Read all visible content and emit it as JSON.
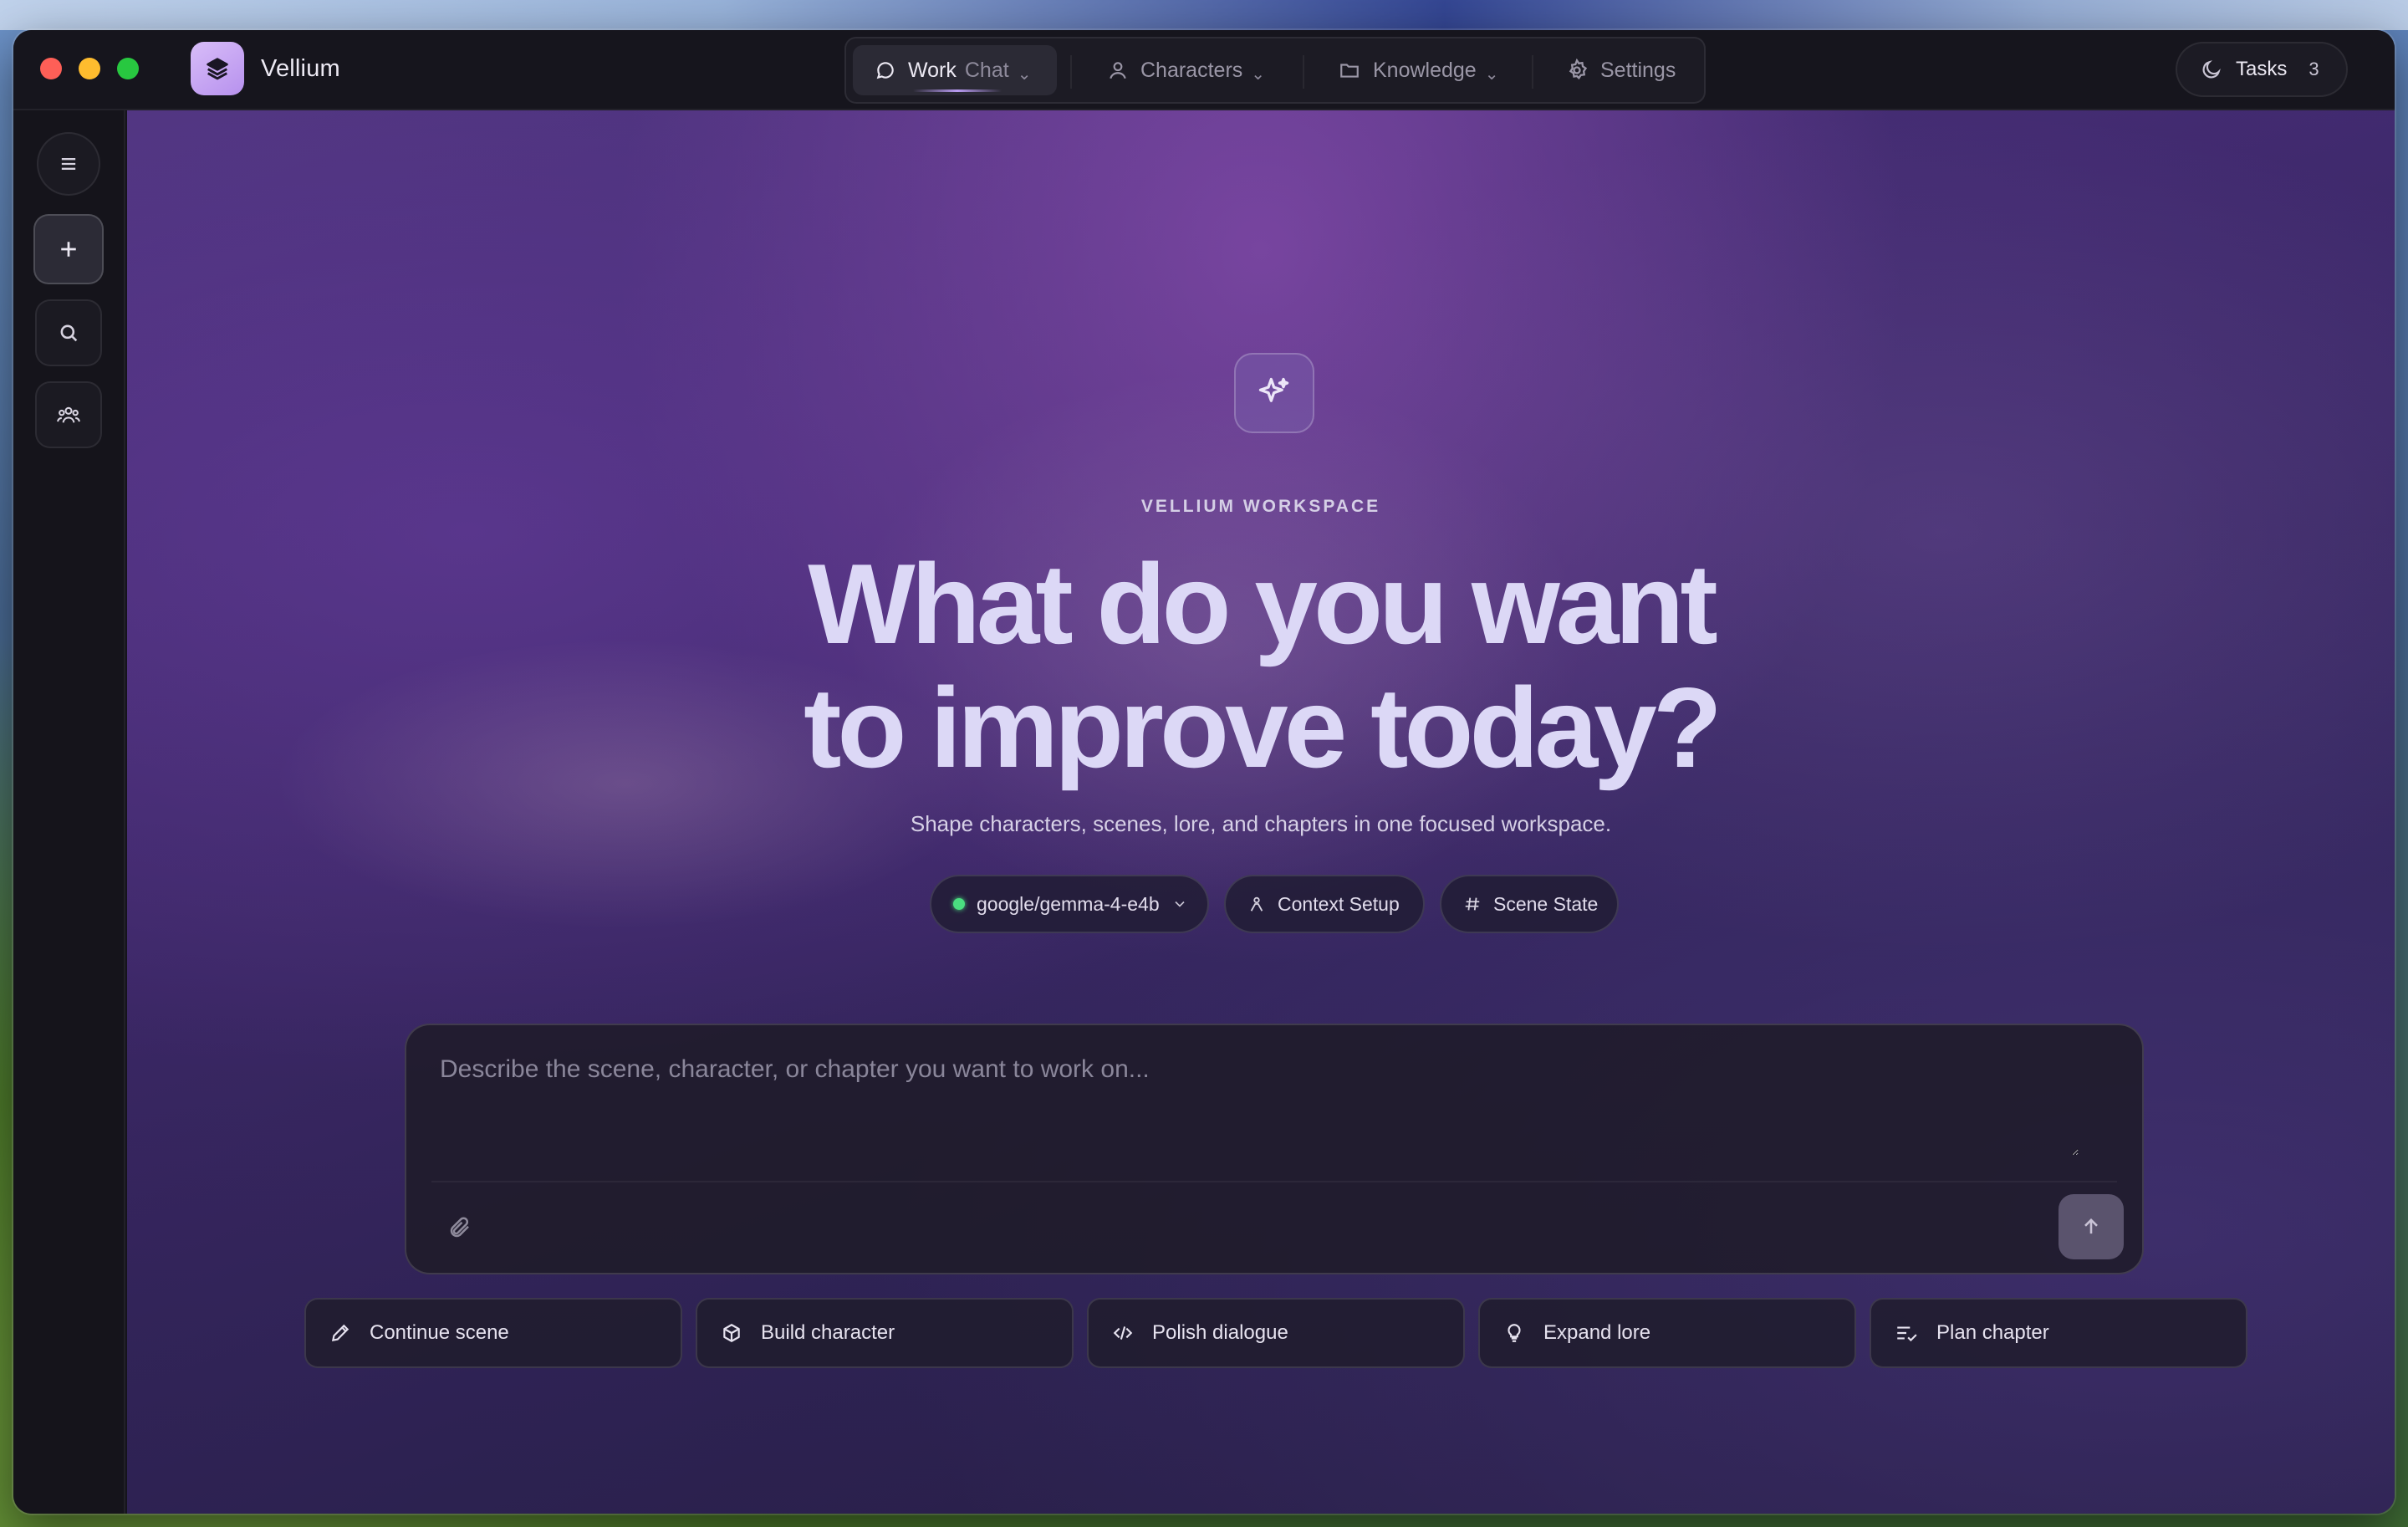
{
  "app": {
    "name": "Vellium"
  },
  "nav": {
    "work_label": "Work",
    "chat_label": "Chat",
    "characters_label": "Characters",
    "knowledge_label": "Knowledge",
    "settings_label": "Settings"
  },
  "tasks": {
    "label": "Tasks",
    "count": "3"
  },
  "hero": {
    "eyebrow": "VELLIUM WORKSPACE",
    "headline_line1": "What do you want",
    "headline_line2": "to improve today?",
    "subline": "Shape characters, scenes, lore, and chapters in one focused workspace."
  },
  "chips": {
    "model": "google/gemma-4-e4b",
    "model_status_color": "#4ade80",
    "context": "Context Setup",
    "scene": "Scene State"
  },
  "composer": {
    "placeholder": "Describe the scene, character, or chapter you want to work on..."
  },
  "quick_actions": [
    {
      "label": "Continue scene",
      "icon": "pencil-icon"
    },
    {
      "label": "Build character",
      "icon": "cube-icon"
    },
    {
      "label": "Polish dialogue",
      "icon": "code-icon"
    },
    {
      "label": "Expand lore",
      "icon": "lightbulb-icon"
    },
    {
      "label": "Plan chapter",
      "icon": "list-check-icon"
    }
  ],
  "colors": {
    "accent": "#b99cf2",
    "logo_bg": "#c9a6f4",
    "window_bg": "#15141c"
  }
}
